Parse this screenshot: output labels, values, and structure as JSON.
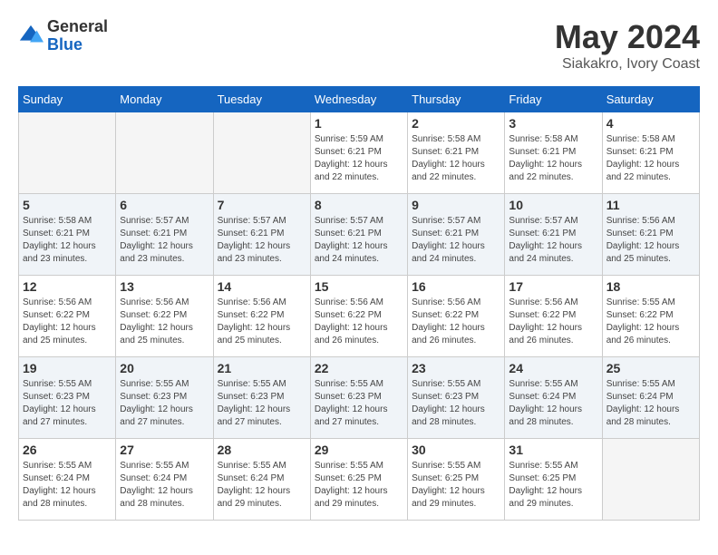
{
  "header": {
    "logo_general": "General",
    "logo_blue": "Blue",
    "month_title": "May 2024",
    "location": "Siakakro, Ivory Coast"
  },
  "calendar": {
    "days_of_week": [
      "Sunday",
      "Monday",
      "Tuesday",
      "Wednesday",
      "Thursday",
      "Friday",
      "Saturday"
    ],
    "weeks": [
      [
        {
          "day": "",
          "empty": true
        },
        {
          "day": "",
          "empty": true
        },
        {
          "day": "",
          "empty": true
        },
        {
          "day": "1",
          "sunrise": "5:59 AM",
          "sunset": "6:21 PM",
          "daylight": "12 hours and 22 minutes."
        },
        {
          "day": "2",
          "sunrise": "5:58 AM",
          "sunset": "6:21 PM",
          "daylight": "12 hours and 22 minutes."
        },
        {
          "day": "3",
          "sunrise": "5:58 AM",
          "sunset": "6:21 PM",
          "daylight": "12 hours and 22 minutes."
        },
        {
          "day": "4",
          "sunrise": "5:58 AM",
          "sunset": "6:21 PM",
          "daylight": "12 hours and 22 minutes."
        }
      ],
      [
        {
          "day": "5",
          "sunrise": "5:58 AM",
          "sunset": "6:21 PM",
          "daylight": "12 hours and 23 minutes."
        },
        {
          "day": "6",
          "sunrise": "5:57 AM",
          "sunset": "6:21 PM",
          "daylight": "12 hours and 23 minutes."
        },
        {
          "day": "7",
          "sunrise": "5:57 AM",
          "sunset": "6:21 PM",
          "daylight": "12 hours and 23 minutes."
        },
        {
          "day": "8",
          "sunrise": "5:57 AM",
          "sunset": "6:21 PM",
          "daylight": "12 hours and 24 minutes."
        },
        {
          "day": "9",
          "sunrise": "5:57 AM",
          "sunset": "6:21 PM",
          "daylight": "12 hours and 24 minutes."
        },
        {
          "day": "10",
          "sunrise": "5:57 AM",
          "sunset": "6:21 PM",
          "daylight": "12 hours and 24 minutes."
        },
        {
          "day": "11",
          "sunrise": "5:56 AM",
          "sunset": "6:21 PM",
          "daylight": "12 hours and 25 minutes."
        }
      ],
      [
        {
          "day": "12",
          "sunrise": "5:56 AM",
          "sunset": "6:22 PM",
          "daylight": "12 hours and 25 minutes."
        },
        {
          "day": "13",
          "sunrise": "5:56 AM",
          "sunset": "6:22 PM",
          "daylight": "12 hours and 25 minutes."
        },
        {
          "day": "14",
          "sunrise": "5:56 AM",
          "sunset": "6:22 PM",
          "daylight": "12 hours and 25 minutes."
        },
        {
          "day": "15",
          "sunrise": "5:56 AM",
          "sunset": "6:22 PM",
          "daylight": "12 hours and 26 minutes."
        },
        {
          "day": "16",
          "sunrise": "5:56 AM",
          "sunset": "6:22 PM",
          "daylight": "12 hours and 26 minutes."
        },
        {
          "day": "17",
          "sunrise": "5:56 AM",
          "sunset": "6:22 PM",
          "daylight": "12 hours and 26 minutes."
        },
        {
          "day": "18",
          "sunrise": "5:55 AM",
          "sunset": "6:22 PM",
          "daylight": "12 hours and 26 minutes."
        }
      ],
      [
        {
          "day": "19",
          "sunrise": "5:55 AM",
          "sunset": "6:23 PM",
          "daylight": "12 hours and 27 minutes."
        },
        {
          "day": "20",
          "sunrise": "5:55 AM",
          "sunset": "6:23 PM",
          "daylight": "12 hours and 27 minutes."
        },
        {
          "day": "21",
          "sunrise": "5:55 AM",
          "sunset": "6:23 PM",
          "daylight": "12 hours and 27 minutes."
        },
        {
          "day": "22",
          "sunrise": "5:55 AM",
          "sunset": "6:23 PM",
          "daylight": "12 hours and 27 minutes."
        },
        {
          "day": "23",
          "sunrise": "5:55 AM",
          "sunset": "6:23 PM",
          "daylight": "12 hours and 28 minutes."
        },
        {
          "day": "24",
          "sunrise": "5:55 AM",
          "sunset": "6:24 PM",
          "daylight": "12 hours and 28 minutes."
        },
        {
          "day": "25",
          "sunrise": "5:55 AM",
          "sunset": "6:24 PM",
          "daylight": "12 hours and 28 minutes."
        }
      ],
      [
        {
          "day": "26",
          "sunrise": "5:55 AM",
          "sunset": "6:24 PM",
          "daylight": "12 hours and 28 minutes."
        },
        {
          "day": "27",
          "sunrise": "5:55 AM",
          "sunset": "6:24 PM",
          "daylight": "12 hours and 28 minutes."
        },
        {
          "day": "28",
          "sunrise": "5:55 AM",
          "sunset": "6:24 PM",
          "daylight": "12 hours and 29 minutes."
        },
        {
          "day": "29",
          "sunrise": "5:55 AM",
          "sunset": "6:25 PM",
          "daylight": "12 hours and 29 minutes."
        },
        {
          "day": "30",
          "sunrise": "5:55 AM",
          "sunset": "6:25 PM",
          "daylight": "12 hours and 29 minutes."
        },
        {
          "day": "31",
          "sunrise": "5:55 AM",
          "sunset": "6:25 PM",
          "daylight": "12 hours and 29 minutes."
        },
        {
          "day": "",
          "empty": true
        }
      ]
    ],
    "labels": {
      "sunrise": "Sunrise:",
      "sunset": "Sunset:",
      "daylight": "Daylight:"
    }
  }
}
